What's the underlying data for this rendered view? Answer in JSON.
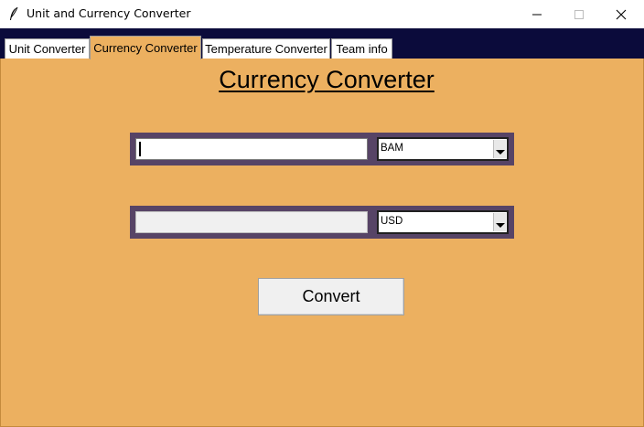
{
  "window": {
    "title": "Unit and Currency Converter",
    "icon": "feather-icon",
    "controls": [
      "minimize-icon",
      "maximize-icon",
      "close-icon"
    ]
  },
  "tabs": [
    {
      "label": "Unit Converter",
      "active": false
    },
    {
      "label": "Currency Converter",
      "active": true
    },
    {
      "label": "Temperature Converter",
      "active": false
    },
    {
      "label": "Team info",
      "active": false
    }
  ],
  "converter": {
    "heading": "Currency Converter",
    "from": {
      "value": "",
      "currency": "BAM"
    },
    "to": {
      "value": "",
      "currency": "USD"
    },
    "convert_label": "Convert"
  },
  "colors": {
    "tabstrip": "#0b0b3b",
    "content_bg": "#ecb060",
    "field_frame": "#574466"
  }
}
